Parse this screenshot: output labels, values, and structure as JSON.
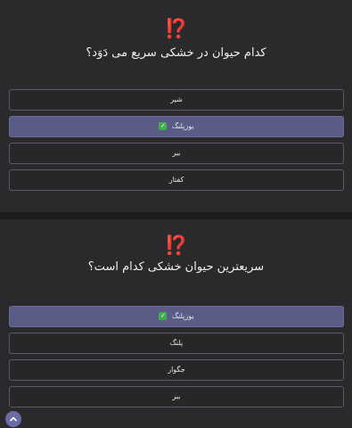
{
  "quiz_1": {
    "emoji": "⁉️",
    "question": "کدام حیوان در خشکی سریع می دَوَد؟",
    "options": [
      {
        "label": "شیر",
        "correct": false
      },
      {
        "label": "یوزپلنگ",
        "correct": true
      },
      {
        "label": "ببر",
        "correct": false
      },
      {
        "label": "کفتار",
        "correct": false
      }
    ]
  },
  "quiz_2": {
    "emoji": "⁉️",
    "question": "سریعترین حیوان خشکی کدام است؟",
    "options": [
      {
        "label": "یوزپلنگ",
        "correct": true
      },
      {
        "label": "پلنگ",
        "correct": false
      },
      {
        "label": "جگوار",
        "correct": false
      },
      {
        "label": "ببر",
        "correct": false
      }
    ]
  },
  "check_mark": "✓",
  "scroll_up_icon": "chevron-up-icon",
  "colors": {
    "selected": "#5a5b87",
    "emoji_red": "#e03a3a",
    "check_green": "#3fb14a",
    "scroll_button": "#6b6ba8"
  }
}
